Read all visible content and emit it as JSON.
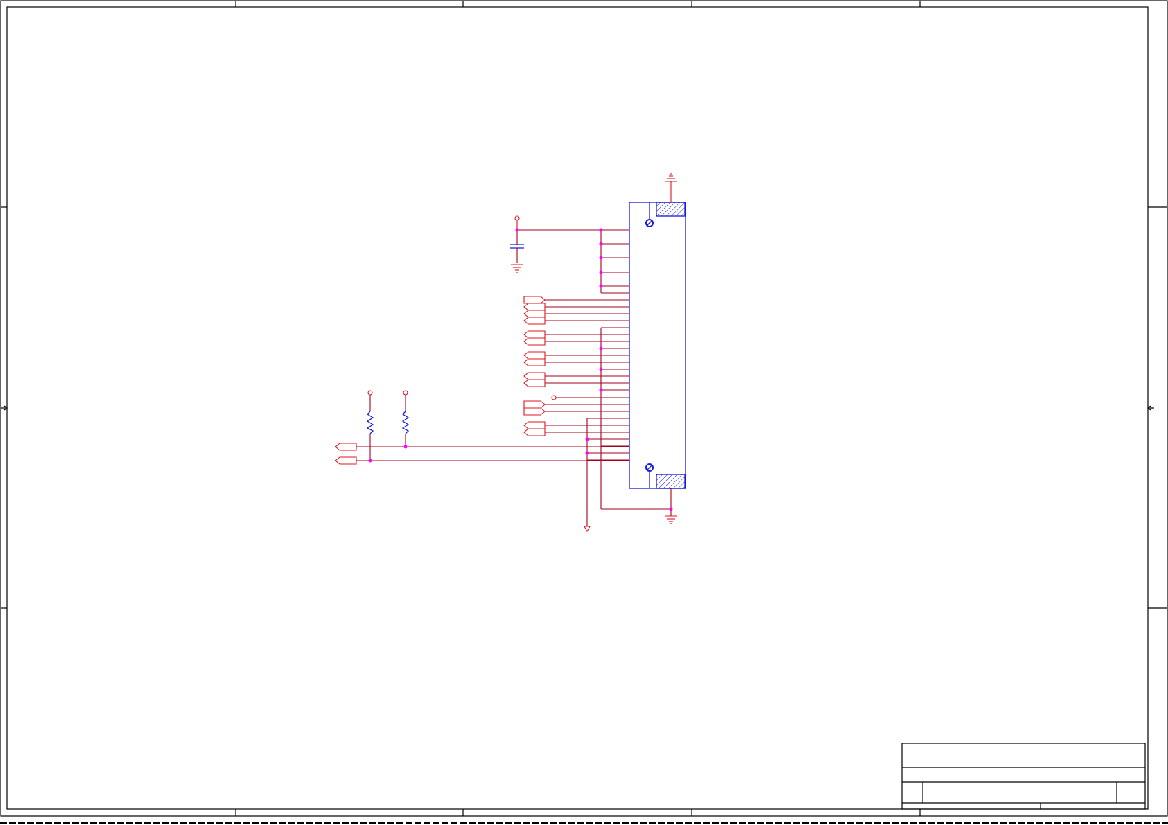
{
  "sheet": {
    "title_block": {
      "title": "",
      "size": "",
      "number": "",
      "revision": "",
      "date": "",
      "sheet": ""
    }
  },
  "colors": {
    "wire": "#a3001e",
    "power_symbol": "#e0141e",
    "component": "#1a1adc",
    "junction": "#ff00ff",
    "frame": "#000000"
  },
  "symbols": {
    "connector": "connector-body",
    "mounting_pads": "hatched-pad-icon",
    "mounting_holes": "mounting-hole-icon",
    "ground": "ground-icon",
    "power": "power-flag-icon",
    "capacitor": "capacitor-icon",
    "resistor": "resistor-icon",
    "off_page": "off-page-connector-icon"
  }
}
